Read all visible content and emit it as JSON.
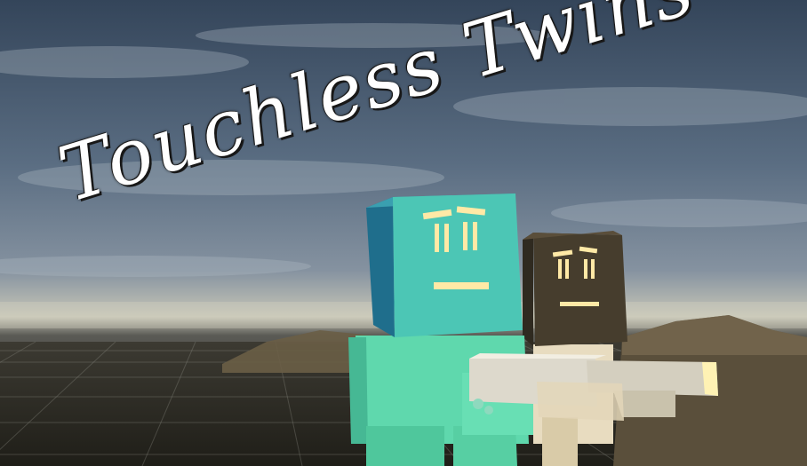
{
  "game": {
    "title": "Touchless Twins",
    "palette": {
      "sky_top": "#34455a",
      "sky_mid": "#6f8196",
      "horizon": "#c7c6b7",
      "ground": "#2b2a22",
      "hill": "#6a5e46",
      "cyan_body": "#5fd8ad",
      "cyan_head_front": "#4cc6b5",
      "cyan_head_side": "#1f6e8c",
      "dark_head": "#463d2d",
      "light_body": "#e8dcc0",
      "gun": "#ddd9cc",
      "glow": "#ffe9a6"
    }
  }
}
